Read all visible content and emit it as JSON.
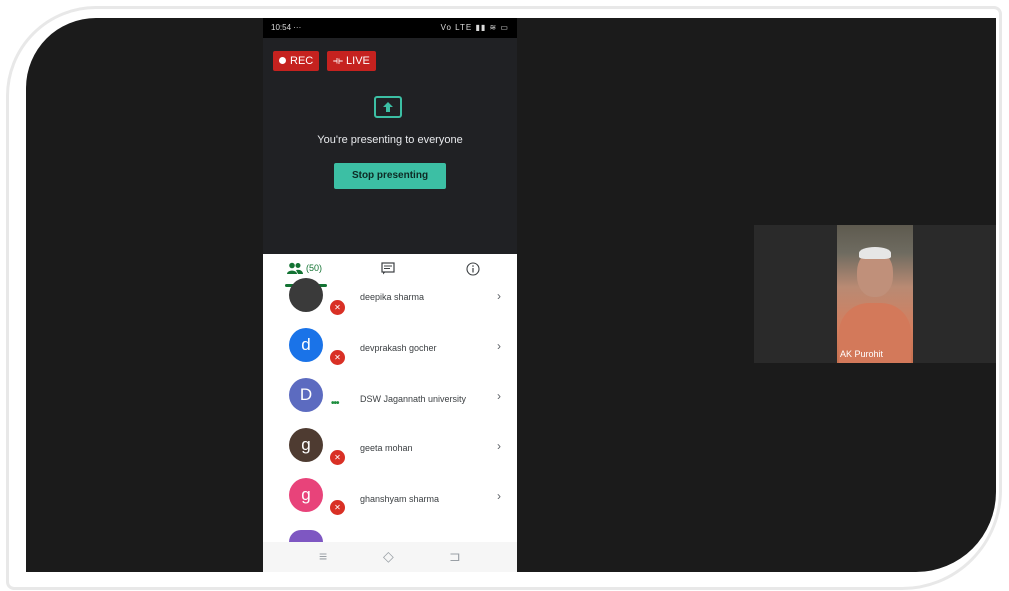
{
  "status_bar": {
    "time": "10:54 ···",
    "icons": "Vo LTE ▮▮ ≋ ▭"
  },
  "badges": {
    "rec": "REC",
    "live": "LIVE"
  },
  "presenting": {
    "message": "You're presenting to everyone",
    "stop_label": "Stop presenting"
  },
  "tabs": {
    "people_count": "(50)"
  },
  "participants": [
    {
      "initial": "",
      "name": "deepika sharma",
      "status": "muted",
      "avatar_color": "#3a3a3a"
    },
    {
      "initial": "d",
      "name": "devprakash gocher",
      "status": "muted",
      "avatar_color": "#1a73e8"
    },
    {
      "initial": "D",
      "name": "DSW Jagannath university",
      "status": "speaking",
      "avatar_color": "#5c6bc0"
    },
    {
      "initial": "g",
      "name": "geeta mohan",
      "status": "muted",
      "avatar_color": "#4e3b31"
    },
    {
      "initial": "g",
      "name": "ghanshyam sharma",
      "status": "muted",
      "avatar_color": "#e8437a"
    }
  ],
  "video_tile": {
    "name": "AK Purohit"
  },
  "colors": {
    "accent": "#3cbfa4",
    "rec": "#c5221f",
    "mute": "#d93025"
  }
}
